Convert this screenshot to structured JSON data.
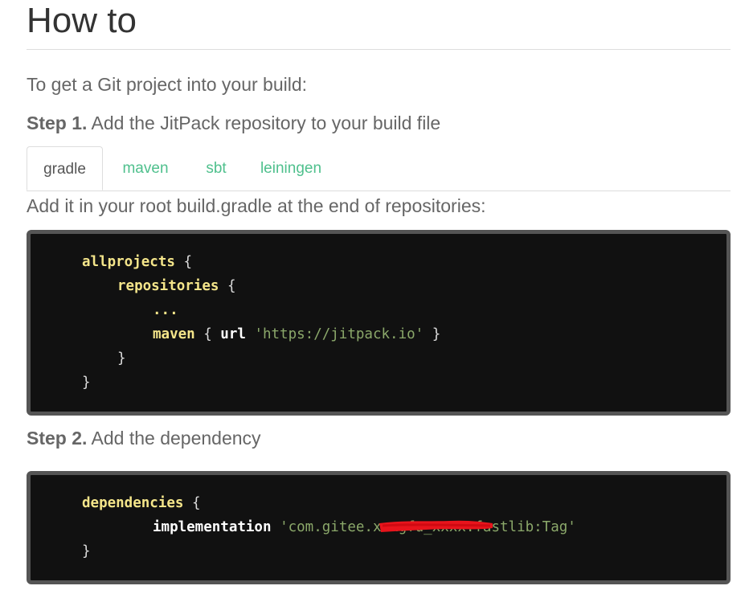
{
  "heading": "How to",
  "intro": "To get a Git project into your build:",
  "step1": {
    "label": "Step 1.",
    "text": " Add the JitPack repository to your build file"
  },
  "tabs": [
    {
      "label": "gradle",
      "active": true
    },
    {
      "label": "maven",
      "active": false
    },
    {
      "label": "sbt",
      "active": false
    },
    {
      "label": "leiningen",
      "active": false
    }
  ],
  "hint": "Add it in your root build.gradle at the end of repositories:",
  "code1": {
    "l1_kw": "allprojects",
    "l1_p": " {",
    "l2_kw": "repositories",
    "l2_p": " {",
    "l3_kw": "...",
    "l4_kw": "maven",
    "l4_p1": " { ",
    "l4_url": "url",
    "l4_str": "'https://jitpack.io'",
    "l4_p2": " }",
    "l5_p": "}",
    "l6_p": "}"
  },
  "step2": {
    "label": "Step 2.",
    "text": " Add the dependency"
  },
  "code2": {
    "l1_kw": "dependencies",
    "l1_p": " {",
    "l2_impl": "implementation",
    "l2_str": "'com.gitee.xxxgfu_xxxx:fastlib:Tag'",
    "l3_p": "}"
  },
  "colors": {
    "accent": "#4fc08d",
    "code_bg": "#111111",
    "code_border": "#555555",
    "keyword": "#f4e58a",
    "string": "#8ba86a",
    "redaction": "#e8141c"
  }
}
